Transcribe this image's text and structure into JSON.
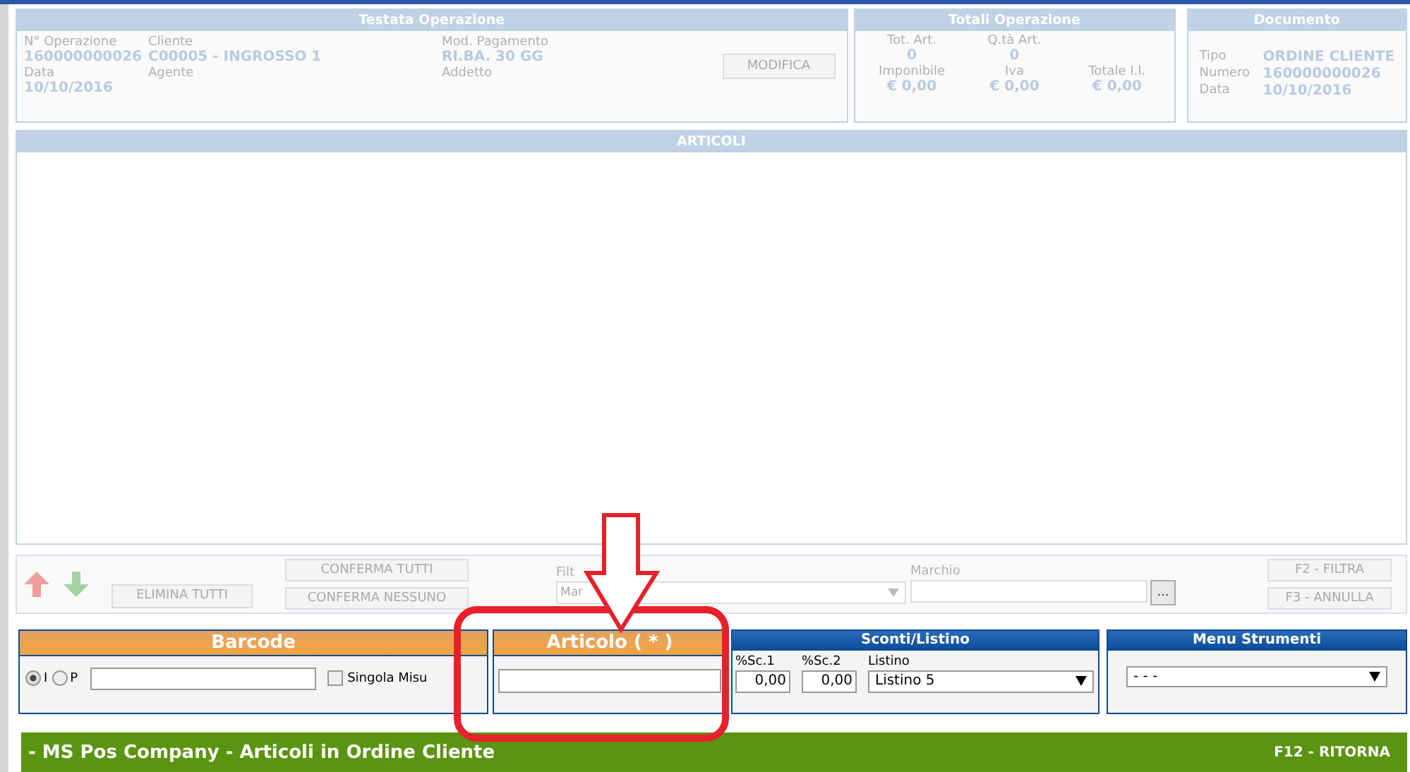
{
  "testata": {
    "title": "Testata Operazione",
    "fields": [
      {
        "label": "N° Operazione",
        "value": "160000000026"
      },
      {
        "label": "Cliente",
        "value": "C00005 - INGROSSO 1"
      },
      {
        "label": "Mod. Pagamento",
        "value": "RI.BA. 30 GG"
      },
      {
        "label": "Data",
        "value": "10/10/2016"
      },
      {
        "label": "Agente"
      },
      {
        "label": "Addetto"
      }
    ],
    "button": {
      "label": "MODIFICA",
      "disabled": true
    }
  },
  "totali": {
    "title": "Totali Operazione",
    "fields": [
      {
        "label": "Tot. Art.",
        "value": "0"
      },
      {
        "label": "Q.tà Art.",
        "value": "0"
      },
      {
        "label": "Imponibile",
        "value": "€ 0,00"
      },
      {
        "label": "Iva",
        "value": "€ 0,00"
      },
      {
        "label": "Totale I.I.",
        "value": "€ 0,00"
      }
    ]
  },
  "documento": {
    "title": "Documento",
    "rows": [
      {
        "label": "Tipo",
        "value": "ORDINE CLIENTE"
      },
      {
        "label": "Numero",
        "value": "160000000026"
      },
      {
        "label": "Data",
        "value": "10/10/2016"
      }
    ]
  },
  "articoli": {
    "title": "ARTICOLI"
  },
  "toolbar": {
    "move_disabled": true,
    "buttons": [
      {
        "label": "ELIMINA TUTTI",
        "disabled": true
      },
      {
        "label": "CONFERMA TUTTI",
        "disabled": true
      },
      {
        "label": "CONFERMA NESSUNO",
        "disabled": true
      }
    ],
    "filter_label": "Filt",
    "filter_select": "Mar",
    "marchio_label": "Marchio",
    "browse_button": "...",
    "right_buttons": [
      {
        "label": "F2 - FILTRA",
        "disabled": true
      },
      {
        "label": "F3 - ANNULLA",
        "disabled": true
      }
    ]
  },
  "barcode": {
    "title": "Barcode",
    "radios": [
      {
        "label": "I",
        "selected": true
      },
      {
        "label": "P",
        "selected": false
      }
    ],
    "checkbox": {
      "label": "Singola Misu",
      "checked": false
    }
  },
  "articolo": {
    "title": "Articolo ( * )"
  },
  "sconti": {
    "title": "Sconti/Listino",
    "fields": [
      {
        "label": "%Sc.1",
        "value": "0,00"
      },
      {
        "label": "%Sc.2",
        "value": "0,00"
      }
    ],
    "listino_label": "Listino",
    "listino": "Listino 5"
  },
  "menu": {
    "title": "Menu Strumenti",
    "value": "- - -"
  },
  "footer": {
    "title": "- MS Pos Company - Articoli in Ordine Cliente",
    "shortcut": "F12 - RITORNA"
  }
}
